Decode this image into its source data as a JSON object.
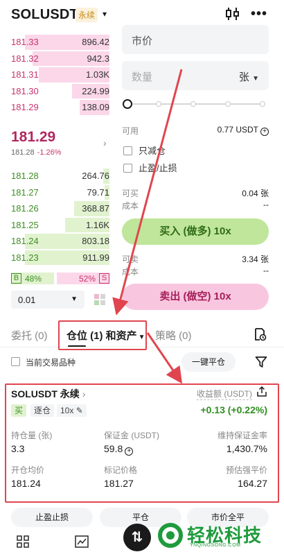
{
  "header": {
    "symbol": "SOLUSDT",
    "badge": "永续",
    "caret": "▾",
    "icons": {
      "chart": "candlestick-chart-icon",
      "more": "more-dots-icon"
    },
    "more_glyph": "•••"
  },
  "orderbook": {
    "asks": [
      {
        "price": "181.33",
        "qty": "896.42",
        "depth": 0.86
      },
      {
        "price": "181.32",
        "qty": "942.3",
        "depth": 0.78
      },
      {
        "price": "181.31",
        "qty": "1.03K",
        "depth": 0.72
      },
      {
        "price": "181.30",
        "qty": "224.99",
        "depth": 0.38
      },
      {
        "price": "181.29",
        "qty": "138.09",
        "depth": 0.3
      }
    ],
    "last_price": "181.29",
    "mark_price": "181.28",
    "change": "-1.26%",
    "bids": [
      {
        "price": "181.28",
        "qty": "264.76",
        "depth": 0.06
      },
      {
        "price": "181.27",
        "qty": "79.71",
        "depth": 0.05
      },
      {
        "price": "181.26",
        "qty": "368.87",
        "depth": 0.36
      },
      {
        "price": "181.25",
        "qty": "1.16K",
        "depth": 0.45
      },
      {
        "price": "181.24",
        "qty": "803.18",
        "depth": 0.86
      },
      {
        "price": "181.23",
        "qty": "911.99",
        "depth": 0.86
      }
    ],
    "buy_label": "B",
    "buy_ratio": "48%",
    "sell_ratio": "52%",
    "sell_label": "S",
    "precision": "0.01"
  },
  "order_form": {
    "order_type": "市价",
    "qty_placeholder": "数量",
    "qty_unit": "张",
    "available_label": "可用",
    "available_value": "0.77 USDT",
    "reduce_only": "只减仓",
    "tp_sl": "止盈/止损",
    "can_buy_label": "可买",
    "can_buy_value": "0.04 张",
    "cost_label": "成本",
    "cost_value": "--",
    "buy_button": "买入 (做多) 10x",
    "can_sell_label": "可卖",
    "can_sell_value": "3.34 张",
    "cost2_label": "成本",
    "cost2_value": "--",
    "sell_button": "卖出 (做空) 10x"
  },
  "tabs": {
    "orders": "委托 (0)",
    "positions": "仓位 (1) 和资产",
    "strategy": "策略 (0)"
  },
  "filter": {
    "current_only": "当前交易品种",
    "close_all": "一键平仓"
  },
  "position": {
    "title": "SOLUSDT 永续",
    "chevron": "›",
    "pnl_label": "收益额 (USDT)",
    "side": "买",
    "margin_mode": "逐仓",
    "leverage": "10x",
    "pnl": "+0.13 (+0.22%)",
    "size_label": "持仓量 (张)",
    "size": "3.3",
    "margin_label": "保证金 (USDT)",
    "margin": "59.8",
    "maint_label": "维持保证金率",
    "maint": "1,430.7%",
    "entry_label": "开仓均价",
    "entry": "181.24",
    "mark_label": "标记价格",
    "mark": "181.27",
    "liq_label": "预估强平价",
    "liq": "164.27"
  },
  "bottom_buttons": {
    "tp_sl": "止盈止损",
    "close": "平仓",
    "market_close": "市价全平"
  },
  "watermark": {
    "logo": "⇅",
    "text": "轻松科技",
    "sub": "YNQINGSONG.COM"
  },
  "colors": {
    "ask": "#c8336c",
    "bid": "#3d8f22",
    "annotation": "#e0454f",
    "profit": "#2e8f1e"
  }
}
